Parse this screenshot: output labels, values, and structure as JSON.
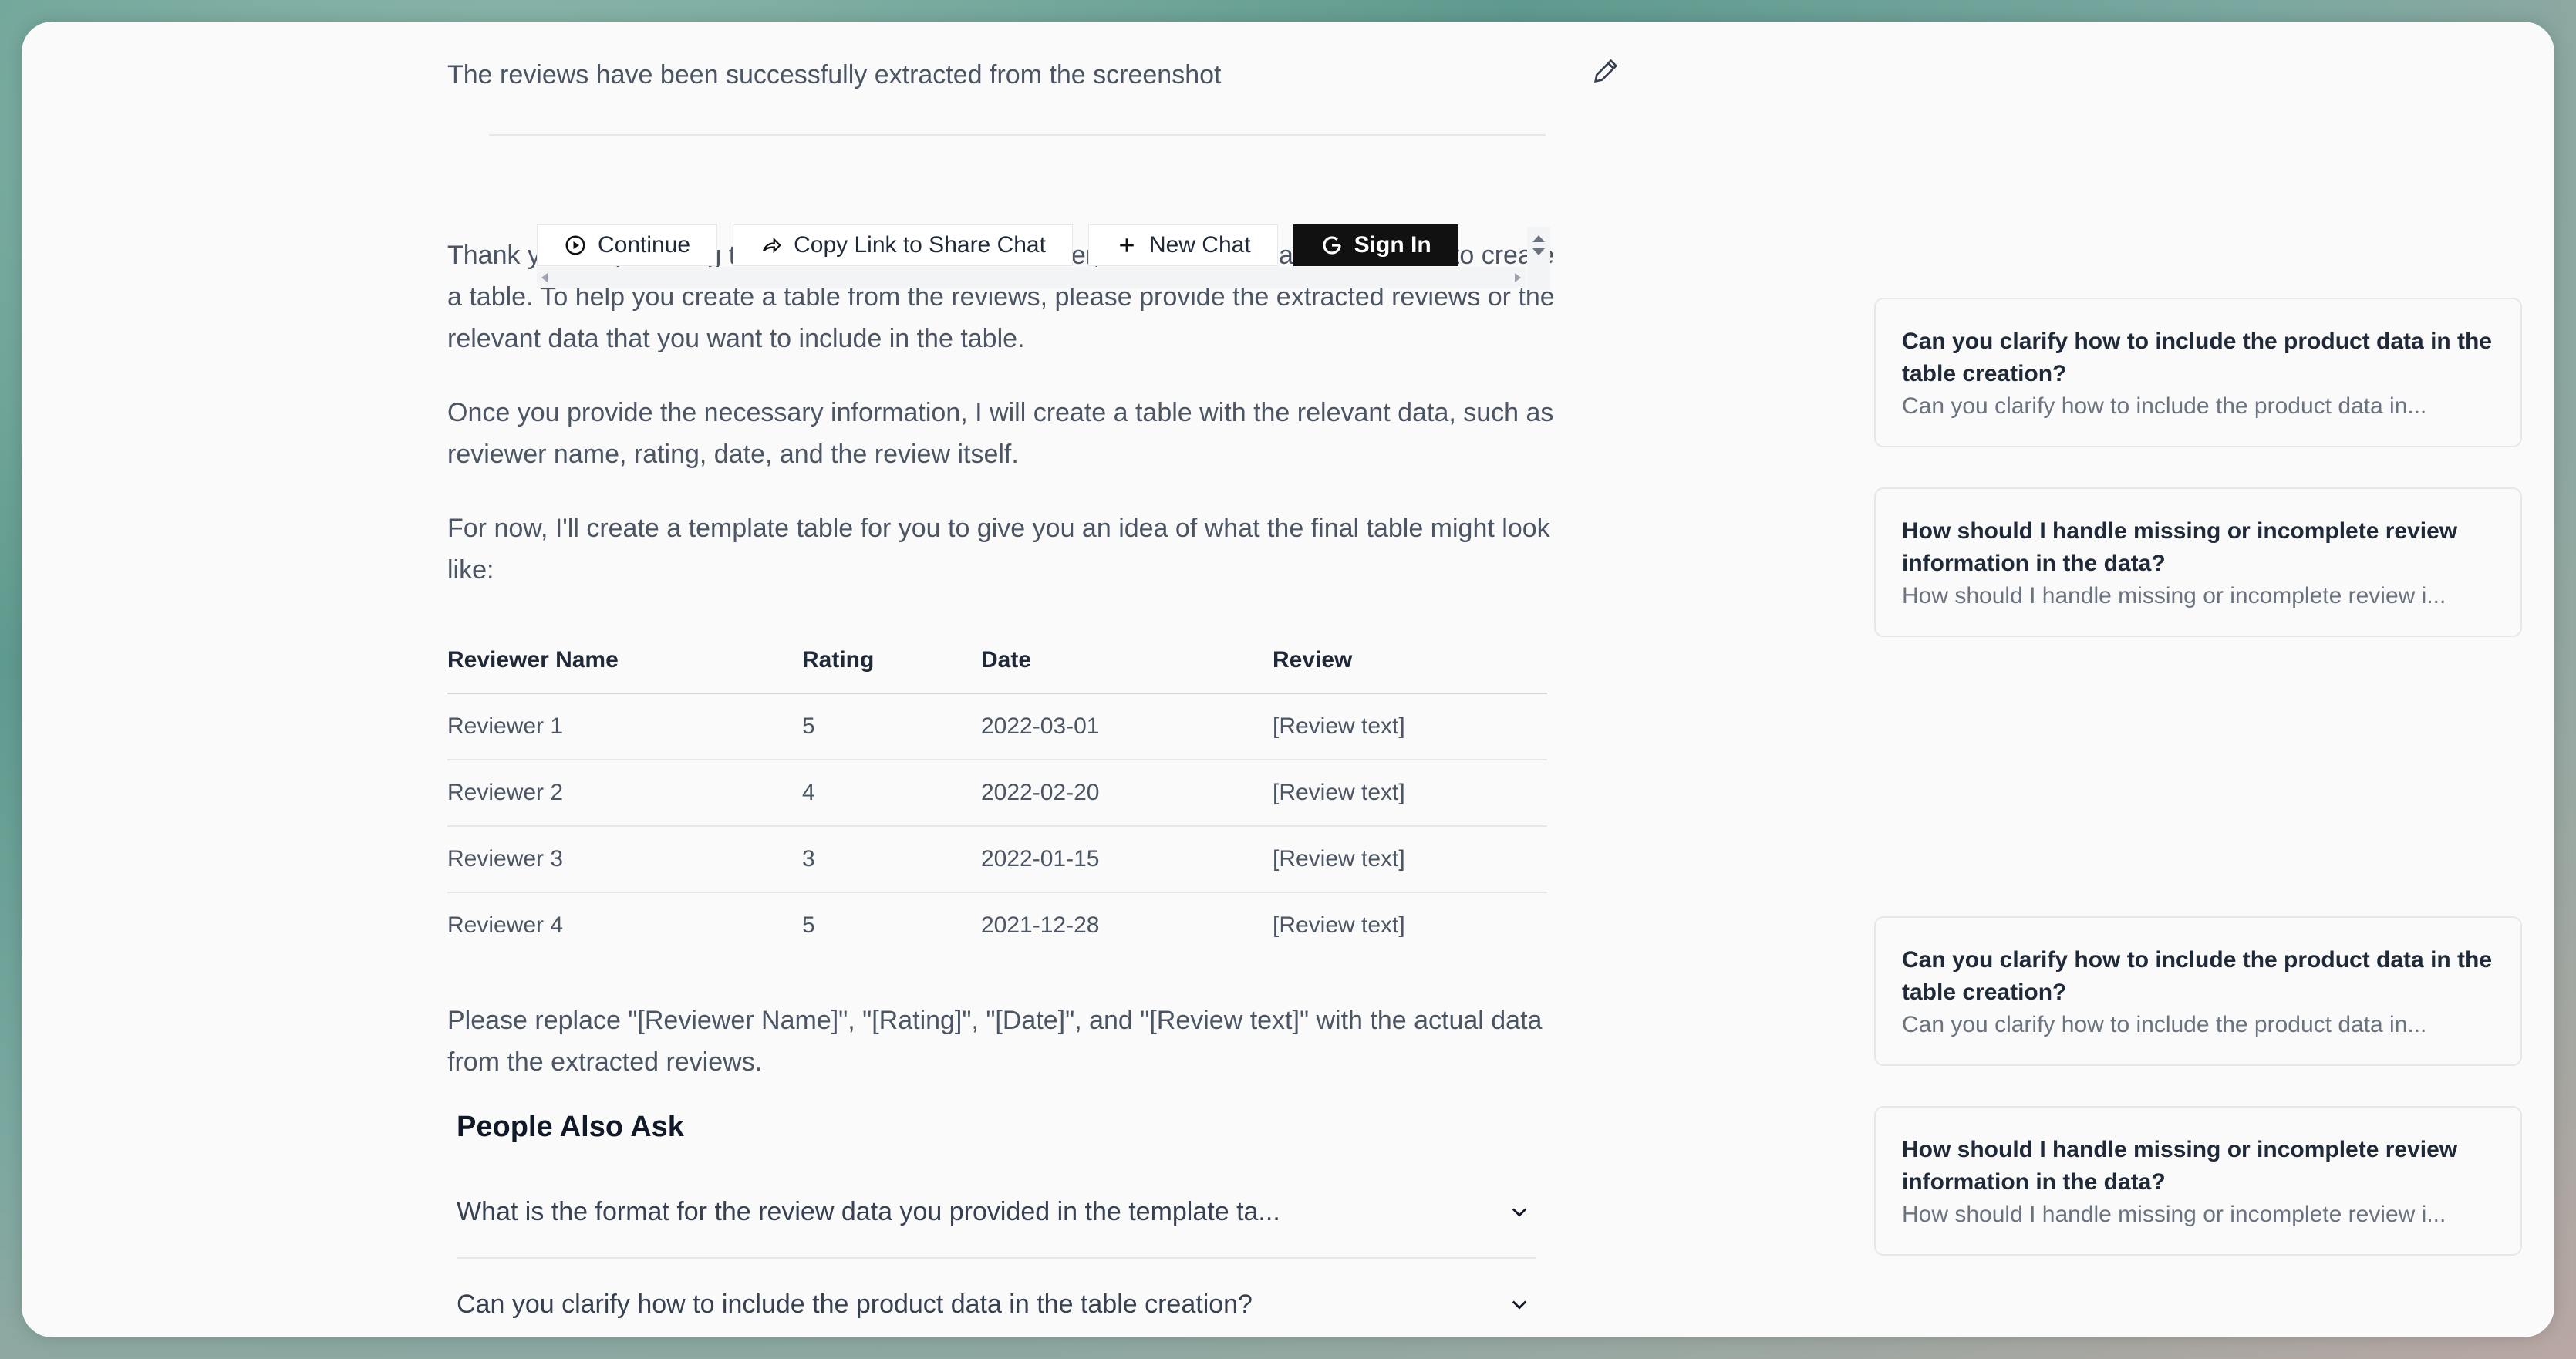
{
  "message": {
    "top_line": "The reviews have been successfully extracted from the screenshot",
    "para1": "Thank you for providing the extracted reviews. However, I don't see the actual reviews to create a table. To help you create a table from the reviews, please provide the extracted reviews or the relevant data that you want to include in the table.",
    "para2": "Once you provide the necessary information, I will create a table with the relevant data, such as reviewer name, rating, date, and the review itself.",
    "para3": "For now, I'll create a template table for you to give you an idea of what the final table might look like:",
    "para4": "Please replace \"[Reviewer Name]\", \"[Rating]\", \"[Date]\", and \"[Review text]\" with the actual data from the extracted reviews."
  },
  "table": {
    "headers": [
      "Reviewer Name",
      "Rating",
      "Date",
      "Review"
    ],
    "rows": [
      [
        "Reviewer 1",
        "5",
        "2022-03-01",
        "[Review text]"
      ],
      [
        "Reviewer 2",
        "4",
        "2022-02-20",
        "[Review text]"
      ],
      [
        "Reviewer 3",
        "3",
        "2022-01-15",
        "[Review text]"
      ],
      [
        "Reviewer 4",
        "5",
        "2021-12-28",
        "[Review text]"
      ]
    ]
  },
  "toolbar": {
    "continue_label": "Continue",
    "copy_link_label": "Copy Link to Share Chat",
    "new_chat_label": "New Chat",
    "sign_in_label": "Sign In"
  },
  "people_also_ask": {
    "title": "People Also Ask",
    "items": [
      "What is the format for the review data you provided in the template ta...",
      "Can you clarify how to include the product data in the table creation?"
    ]
  },
  "related_cards": [
    {
      "question": "Can you clarify how to include the product data in the table creation?",
      "snippet": "Can you clarify how to include the product data in..."
    },
    {
      "question": "How should I handle missing or incomplete review information in the data?",
      "snippet": "How should I handle missing or incomplete review i..."
    },
    {
      "question": "Can you clarify how to include the product data in the table creation?",
      "snippet": "Can you clarify how to include the product data in..."
    },
    {
      "question": "How should I handle missing or incomplete review information in the data?",
      "snippet": "How should I handle missing or incomplete review i..."
    }
  ],
  "icons": {
    "edit": "pencil-icon",
    "continue": "play-circle-icon",
    "share": "share-icon",
    "new_chat": "plus-icon",
    "sign_in": "google-icon",
    "expand": "chevron-down-icon"
  }
}
